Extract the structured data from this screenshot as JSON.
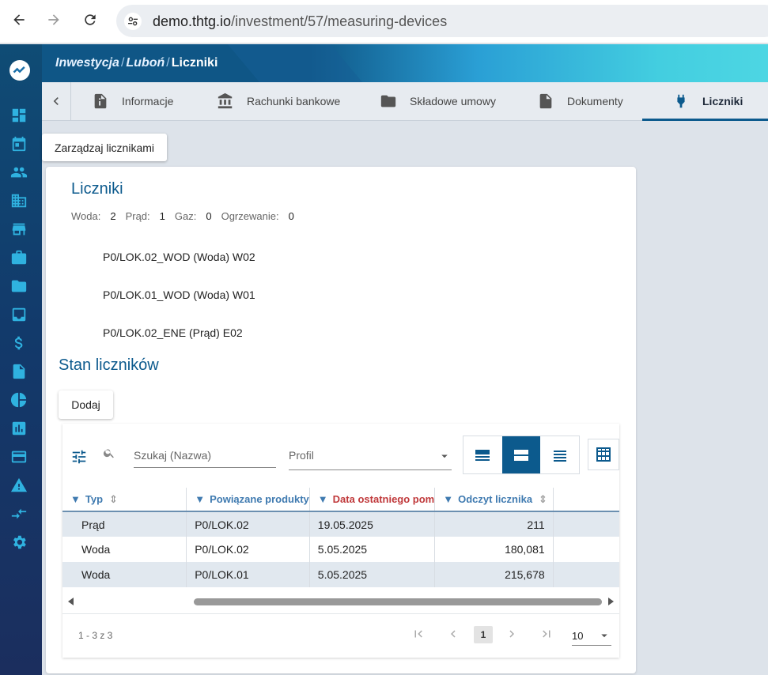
{
  "browser": {
    "url_host": "demo.thtg.io",
    "url_path": "/investment/57/measuring-devices"
  },
  "header": {
    "crumb1": "Inwestycja",
    "crumb2": "Luboń",
    "crumb3": "Liczniki"
  },
  "tabs": [
    {
      "label": "Informacje",
      "icon": "info-document-icon"
    },
    {
      "label": "Rachunki bankowe",
      "icon": "bank-icon"
    },
    {
      "label": "Składowe umowy",
      "icon": "folder-icon"
    },
    {
      "label": "Dokumenty",
      "icon": "document-icon"
    },
    {
      "label": "Liczniki",
      "icon": "plug-icon",
      "active": true
    }
  ],
  "manage_button": "Zarządzaj licznikami",
  "card": {
    "title": "Liczniki",
    "counts": [
      {
        "label": "Woda:",
        "value": "2"
      },
      {
        "label": "Prąd:",
        "value": "1"
      },
      {
        "label": "Gaz:",
        "value": "0"
      },
      {
        "label": "Ogrzewanie:",
        "value": "0"
      }
    ],
    "devices": [
      "P0/LOK.02_WOD (Woda) W02",
      "P0/LOK.01_WOD (Woda) W01",
      "P0/LOK.02_ENE (Prąd) E02"
    ],
    "state_title": "Stan liczników",
    "add_button": "Dodaj"
  },
  "grid": {
    "search_placeholder": "Szukaj (Nazwa)",
    "profile_placeholder": "Profil",
    "columns": [
      "Typ",
      "Powiązane produkty",
      "Data ostatniego pom",
      "Odczyt licznika"
    ],
    "rows": [
      [
        "Prąd",
        "P0/LOK.02",
        "19.05.2025",
        "211"
      ],
      [
        "Woda",
        "P0/LOK.02",
        "5.05.2025",
        "180,081"
      ],
      [
        "Woda",
        "P0/LOK.01",
        "5.05.2025",
        "215,678"
      ]
    ],
    "pager_info": "1 - 3 z 3",
    "current_page": "1",
    "page_size": "10"
  },
  "colors": {
    "accent": "#0c5a8d",
    "sidebar_icon": "#2fb2e0",
    "sorted_header": "#c0393b"
  }
}
